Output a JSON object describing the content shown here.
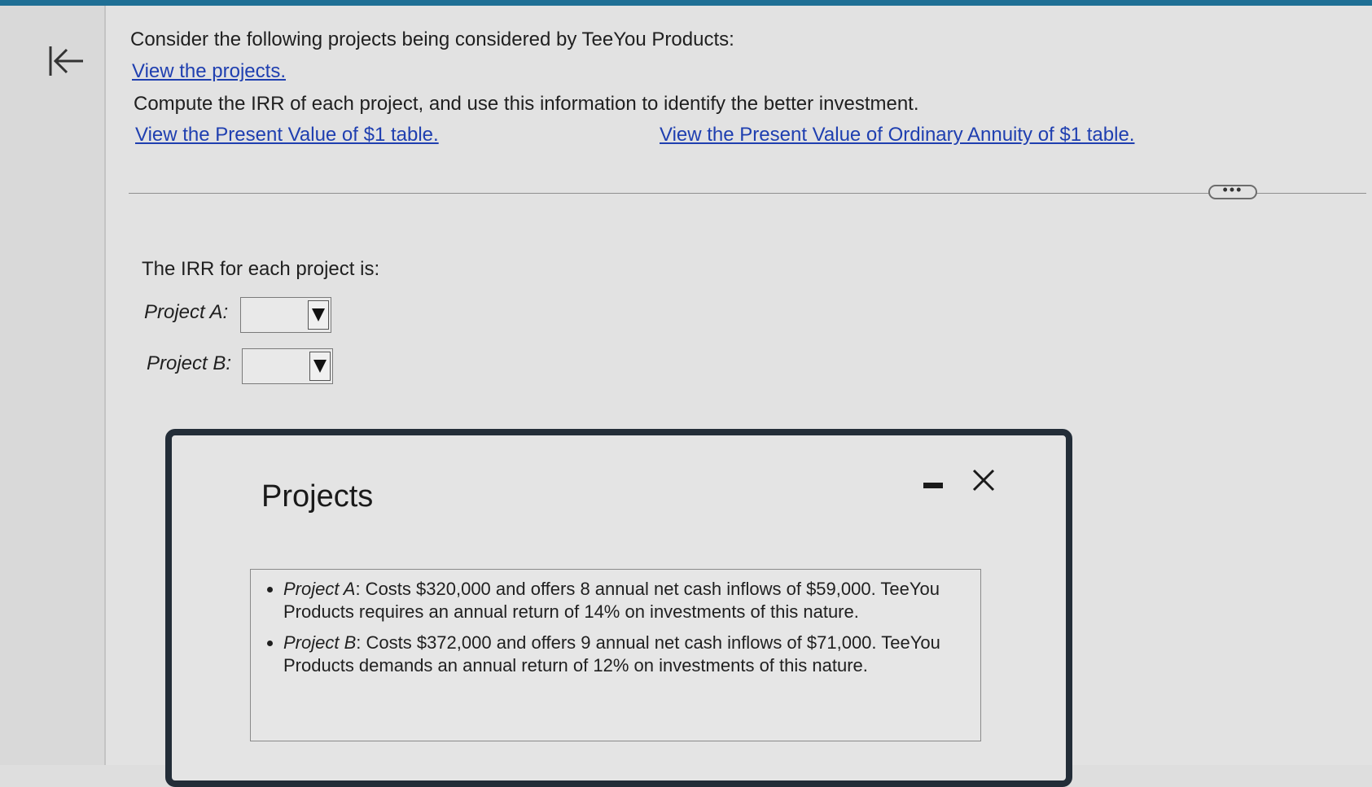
{
  "intro": {
    "question_line": "Consider the following projects being considered by TeeYou Products:",
    "view_projects_link": "View the projects.",
    "instruction_line": "Compute the IRR of each project, and use this information to identify the better investment.",
    "pv_table_link": "View the Present Value of $1 table.",
    "annuity_table_link": "View the Present Value of Ordinary Annuity of $1 table."
  },
  "answer": {
    "heading": "The IRR for each project is:",
    "project_a_label": "Project A:",
    "project_b_label": "Project B:",
    "project_a_value": "",
    "project_b_value": ""
  },
  "modal": {
    "title": "Projects",
    "items": [
      {
        "name": "Project A",
        "text": ": Costs $320,000 and offers 8 annual net cash inflows of $59,000. TeeYou Products requires an annual return of 14% on investments of this nature."
      },
      {
        "name": "Project B",
        "text": ": Costs $372,000 and offers 9 annual net cash inflows of $71,000. TeeYou Products demands an annual return of 12% on investments of this nature."
      }
    ]
  },
  "colors": {
    "accent_bar": "#1f6f95",
    "link": "#1f3fb0",
    "modal_border": "#232d38"
  },
  "icons": {
    "back": "arrow-left-to-bar-icon",
    "more": "ellipsis-icon",
    "minimize": "minimize-icon",
    "close": "close-x-icon",
    "dropdown": "triangle-down-icon"
  }
}
